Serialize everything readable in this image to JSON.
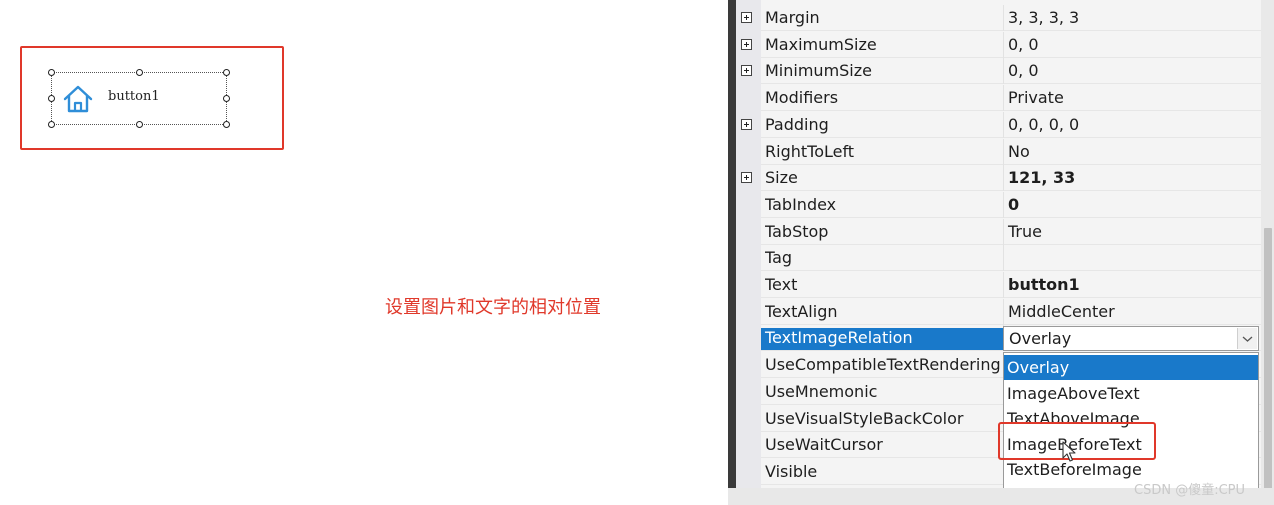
{
  "designer": {
    "button_text": "button1",
    "icon": "house-icon"
  },
  "caption": "设置图片和文字的相对位置",
  "property_grid": {
    "rows": [
      {
        "name": "Margin",
        "value": "3, 3, 3, 3",
        "expandable": true
      },
      {
        "name": "MaximumSize",
        "value": "0, 0",
        "expandable": true
      },
      {
        "name": "MinimumSize",
        "value": "0, 0",
        "expandable": true
      },
      {
        "name": "Modifiers",
        "value": "Private",
        "expandable": false
      },
      {
        "name": "Padding",
        "value": "0, 0, 0, 0",
        "expandable": true
      },
      {
        "name": "RightToLeft",
        "value": "No",
        "expandable": false
      },
      {
        "name": "Size",
        "value": "121, 33",
        "expandable": true,
        "bold": true
      },
      {
        "name": "TabIndex",
        "value": "0",
        "expandable": false,
        "bold": true
      },
      {
        "name": "TabStop",
        "value": "True",
        "expandable": false
      },
      {
        "name": "Tag",
        "value": "",
        "expandable": false
      },
      {
        "name": "Text",
        "value": "button1",
        "expandable": false,
        "bold": true
      },
      {
        "name": "TextAlign",
        "value": "MiddleCenter",
        "expandable": false
      },
      {
        "name": "TextImageRelation",
        "value": "Overlay",
        "expandable": false,
        "selected": true
      },
      {
        "name": "UseCompatibleTextRendering",
        "value": "",
        "expandable": false
      },
      {
        "name": "UseMnemonic",
        "value": "",
        "expandable": false
      },
      {
        "name": "UseVisualStyleBackColor",
        "value": "",
        "expandable": false
      },
      {
        "name": "UseWaitCursor",
        "value": "",
        "expandable": false
      },
      {
        "name": "Visible",
        "value": "",
        "expandable": false
      }
    ],
    "dropdown": {
      "current_value": "Overlay",
      "options": [
        "Overlay",
        "ImageAboveText",
        "TextAboveImage",
        "ImageBeforeText",
        "TextBeforeImage"
      ],
      "selected_option": "Overlay",
      "highlighted_option": "ImageBeforeText"
    }
  },
  "watermark": "CSDN @傻童:CPU",
  "colors": {
    "highlight_red": "#e0382a",
    "selection_blue": "#1979ca"
  }
}
